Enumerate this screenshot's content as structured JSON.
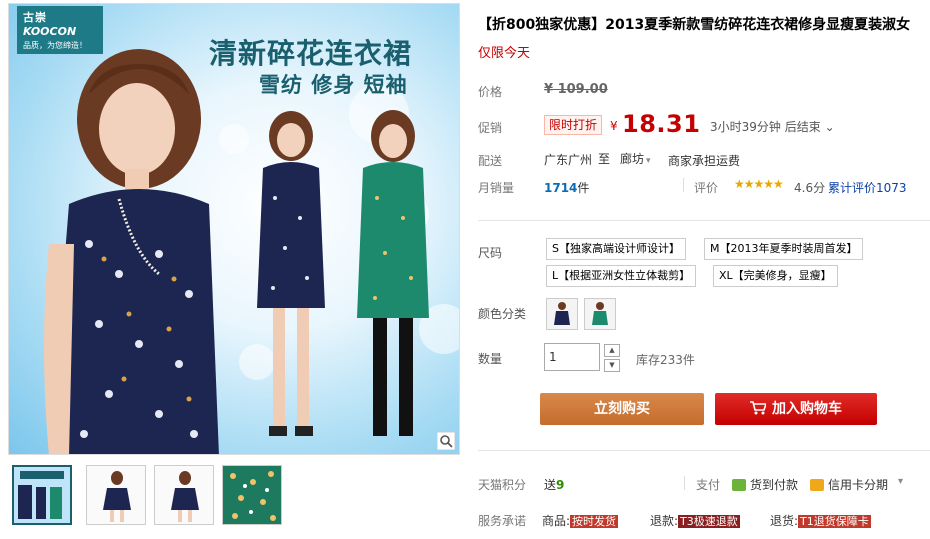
{
  "brand": {
    "name_cn": "古崇",
    "name_en": "KOOCON",
    "slogan": "品质，为您缔造！"
  },
  "banner": {
    "title": "清新碎花连衣裙",
    "subtitle": "雪纺 修身 短袖"
  },
  "product": {
    "title": "【折800独家优惠】2013夏季新款雪纺碎花连衣裙修身显瘦夏装淑女",
    "subtitle": "仅限今天"
  },
  "price": {
    "label": "价格",
    "original": "¥ 109.00",
    "promo_label": "促销",
    "promo_tag": "限时打折",
    "yen": "¥",
    "current": "18.31",
    "countdown": "3小时39分钟 后结束",
    "countdown_caret": "⌄"
  },
  "shipping": {
    "label": "配送",
    "from": "广东广州",
    "to_prefix": "至",
    "to": "廊坊",
    "caret": "▾",
    "fee": "商家承担运费"
  },
  "sales": {
    "label": "月销量",
    "count": "1714",
    "unit": "件",
    "rating_label": "评价",
    "stars": "★★★★★",
    "score": "4.6分",
    "review_count": "累计评价1073"
  },
  "options": {
    "size_label": "尺码",
    "sizes": [
      "S【独家高端设计师设计】",
      "M【2013年夏季时装周首发】",
      "L【根据亚洲女性立体裁剪】",
      "XL【完美修身，显瘦】"
    ],
    "color_label": "颜色分类",
    "colors": [
      "navy-floral",
      "green-floral"
    ],
    "qty_label": "数量",
    "qty_value": "1",
    "qty_up": "▲",
    "qty_down": "▼",
    "stock": "库存233件"
  },
  "actions": {
    "buy": "立刻购买",
    "cart": "加入购物车"
  },
  "footer": {
    "points_label": "天猫积分",
    "points_prefix": "送",
    "points_value": "9",
    "pay_label": "支付",
    "pay_cod": "货到付款",
    "pay_credit": "信用卡分期",
    "pay_more": "▾",
    "promise_label": "服务承诺",
    "promise_goods": "商品:",
    "promise_goods_tag": "按时发货",
    "promise_refund": "退款:",
    "promise_refund_tag": "T3极速退款",
    "promise_return": "退货:",
    "promise_return_tag": "T1退货保障卡"
  },
  "colors": {
    "price_red": "#c40000",
    "buy_orange": "#cf7a3d",
    "cart_red": "#d21f1b",
    "link_blue": "#0b6cb6",
    "brand_teal": "#1e7a86",
    "star_gold": "#e8a800"
  },
  "icons": [
    "zoom-icon",
    "cart-icon",
    "cod-icon",
    "credit-card-icon",
    "chevron-down-icon"
  ]
}
